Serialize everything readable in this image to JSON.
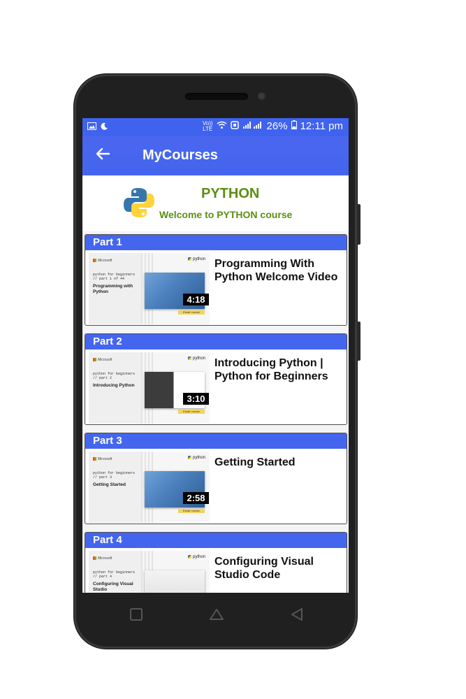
{
  "status": {
    "net_label_top": "Vo))",
    "net_label_bottom": "LTE",
    "battery": "26%",
    "time": "12:11 pm"
  },
  "appbar": {
    "title": "MyCourses"
  },
  "course": {
    "name": "PYTHON",
    "welcome": "Welcome to PYTHON course"
  },
  "parts": [
    {
      "label": "Part 1",
      "title": "Programming With Python Welcome Video",
      "duration": "4:18",
      "thumb_series": "python for beginners",
      "thumb_part": "// part 1 of 44",
      "thumb_title": "Programming with Python"
    },
    {
      "label": "Part 2",
      "title": "Introducing Python | Python for Beginners",
      "duration": "3:10",
      "thumb_series": "python for beginners",
      "thumb_part": "// part 2",
      "thumb_title": "Introducing Python"
    },
    {
      "label": "Part 3",
      "title": "Getting Started",
      "duration": "2:58",
      "thumb_series": "python for beginners",
      "thumb_part": "// part 3",
      "thumb_title": "Getting Started"
    },
    {
      "label": "Part 4",
      "title": "Configuring Visual Studio Code",
      "duration": "",
      "thumb_series": "python for beginners",
      "thumb_part": "// part 4",
      "thumb_title": "Configuring Visual Studio"
    }
  ],
  "thumb_common": {
    "ms": "Microsoft",
    "py": "python",
    "tag": "Email: novice"
  },
  "icons": {
    "back": "arrow-left",
    "nav": [
      "recent-apps-square",
      "home-triangle",
      "back-triangle"
    ]
  }
}
